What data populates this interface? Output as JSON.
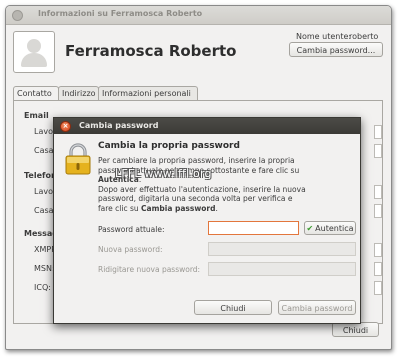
{
  "window": {
    "title": "Informazioni su Ferramosca Roberto",
    "user_full_name": "Ferramosca Roberto",
    "username_label": "Nome utente:",
    "username_value": "roberto",
    "change_password_button": "Cambia password...",
    "tabs": [
      {
        "label": "Contatto",
        "active": true
      },
      {
        "label": "Indirizzo",
        "active": false
      },
      {
        "label": "Informazioni personali",
        "active": false
      }
    ],
    "sections": {
      "email": "Email",
      "phone": "Telefono",
      "messaging": "Messaggi"
    },
    "fields": {
      "work": "Lavoro:",
      "home": "Casa:",
      "phone_work": "Lavoro:",
      "phone_home": "Casa:",
      "xmpp": "XMPP:",
      "msn": "MSN:",
      "icq": "ICQ:"
    },
    "close_button": "Chiudi"
  },
  "dialog": {
    "title": "Cambia password",
    "heading": "Cambia la propria password",
    "current_password_label": "Password attuale:",
    "authenticate_button": "Autentica",
    "new_password_label": "Nuova password:",
    "retype_password_label": "Ridigitare nuova password:",
    "close_button": "Chiudi",
    "change_button": "Cambia password"
  },
  "watermark": "LFFL www.lffl.org",
  "icons": [
    "avatar-icon",
    "lock-icon",
    "close-icon",
    "checkmark-icon"
  ],
  "colors": {
    "dialog_titlebar": "#3b3a36",
    "close_button": "#d8431b",
    "focus_border": "#e3763c",
    "check": "#3a9b2e"
  }
}
